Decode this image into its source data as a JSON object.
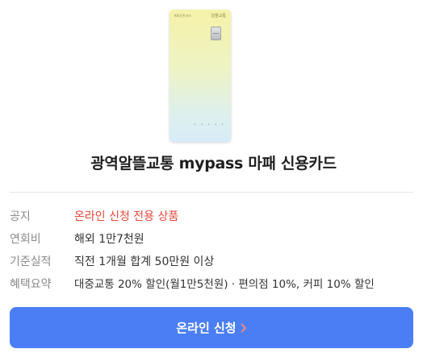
{
  "card": {
    "image_label": "card-image",
    "brand": "KB국민카드",
    "kr_mark": "알뜰교통"
  },
  "title": "광역알뜰교통 mypass 마패 신용카드",
  "info": [
    {
      "label": "공지",
      "value": "온라인 신청 전용 상품"
    },
    {
      "label": "연회비",
      "value": "해외 1만7천원"
    },
    {
      "label": "기준실적",
      "value": "직전 1개월 합계 50만원 이상"
    },
    {
      "label": "혜택요약",
      "value": "대중교통 20% 할인(월1만5천원) · 편의점 10%, 커피 10% 할인"
    }
  ],
  "cta": {
    "label": "온라인 신청"
  },
  "colors": {
    "accent": "#4b7ef4",
    "notice": "#e5483b",
    "arrow": "#ff8a7a"
  }
}
